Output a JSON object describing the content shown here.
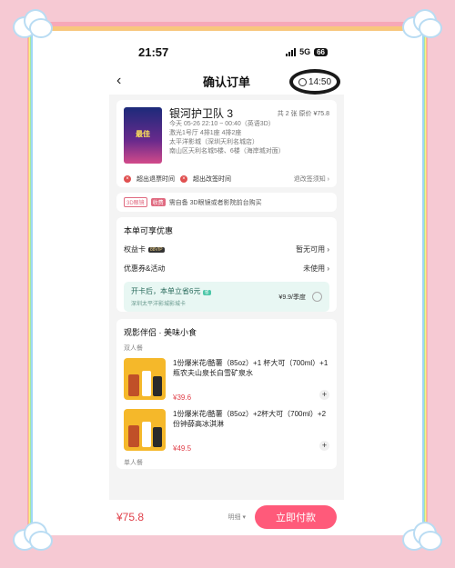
{
  "status_bar": {
    "time": "21:57",
    "network": "5G",
    "battery": "66"
  },
  "header": {
    "title": "确认订单",
    "back_icon": "chevron-left-icon",
    "timer": "14:50"
  },
  "movie": {
    "poster_text": "最佳",
    "title": "银河护卫队 3",
    "quantity": "共 2 张 原价 ¥75.8",
    "lines": [
      "今天 05-26 22:10 ~ 00:40（英语3D）",
      "激光1号厅 4排1座 4排2座",
      "太平洋影城（深圳天利名城店）",
      "南山区天利名城5楼、6楼（海岸城对面）"
    ]
  },
  "policy": {
    "refund": "超出退票时间",
    "change": "超出改签时间",
    "notice_link": "退改签须知"
  },
  "glasses_notice": {
    "tag": "3D眼镜",
    "tag2": "收费",
    "text": "需自备 3D眼镜或者影院前台购买"
  },
  "discount": {
    "section_title": "本单可享优惠",
    "rows": [
      {
        "label": "权益卡",
        "badge": "88VIP",
        "value": "暂无可用"
      },
      {
        "label": "优惠券&活动",
        "value": "未使用"
      }
    ],
    "promo": {
      "line1": "开卡后，本单立省6元",
      "save_tag": "省",
      "line2": "深圳太平洋影城影城卡",
      "price": "¥9.9/季度"
    }
  },
  "snacks": {
    "section_title": "观影伴侣 · 美味小食",
    "double_label": "双人餐",
    "single_label": "单人餐",
    "items": [
      {
        "desc": "1份爆米花/酷薯（85oz）+1 杯大可（700ml）+1瓶农夫山泉长白雪矿泉水",
        "price": "¥39.6"
      },
      {
        "desc": "1份爆米花/酷薯（85oz）+2杯大可（700ml）+2份钟薛高冰淇淋",
        "price": "¥49.5"
      }
    ]
  },
  "footer": {
    "total": "¥75.8",
    "detail": "明细",
    "pay_label": "立即付款"
  }
}
